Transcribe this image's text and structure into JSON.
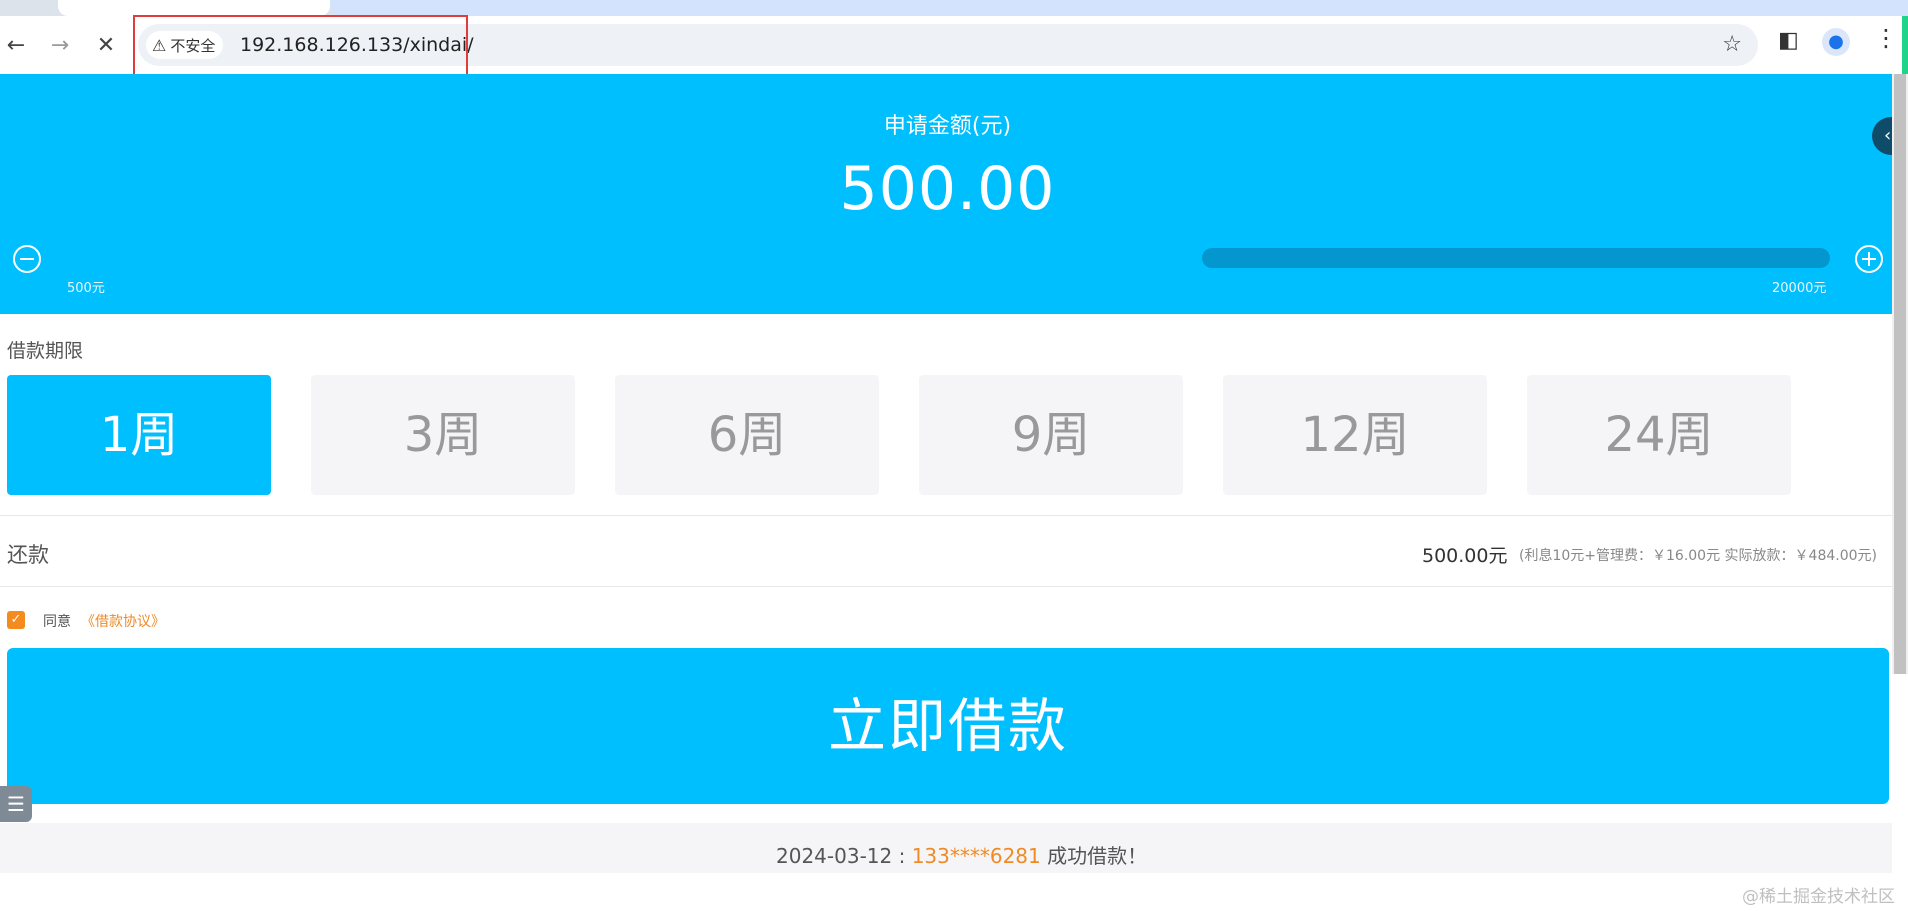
{
  "browser": {
    "url": "192.168.126.133/xindai/",
    "security_label": "不安全",
    "icons": {
      "back": "arrow-left-icon",
      "forward": "arrow-right-icon",
      "stop": "close-icon",
      "warning": "warning-triangle-icon",
      "bookmark": "star-icon",
      "sidepanel": "side-panel-icon",
      "profile": "person-icon",
      "menu": "kebab-menu-icon"
    }
  },
  "hero": {
    "title": "申请金额(元)",
    "amount": "500.00",
    "min_label": "500元",
    "max_label": "20000元",
    "slider_fraction": 0.0,
    "color": "#00bfff"
  },
  "loan_term": {
    "label": "借款期限",
    "options": [
      "1周",
      "3周",
      "6周",
      "9周",
      "12周",
      "24周"
    ],
    "selected": "1周"
  },
  "repayment": {
    "label": "还款",
    "amount": "500.00元",
    "detail": "(利息10元+管理费：￥16.00元 实际放款：￥484.00元)"
  },
  "agreement": {
    "checked": true,
    "prefix": "同意",
    "link": "《借款协议》",
    "link_color": "#f08a24"
  },
  "submit_label": "立即借款",
  "ticker": [
    {
      "date": "2024-03-12 : ",
      "phone": "133****6281",
      "text": " 成功借款！"
    }
  ],
  "watermark": "@稀土掘金技术社区"
}
